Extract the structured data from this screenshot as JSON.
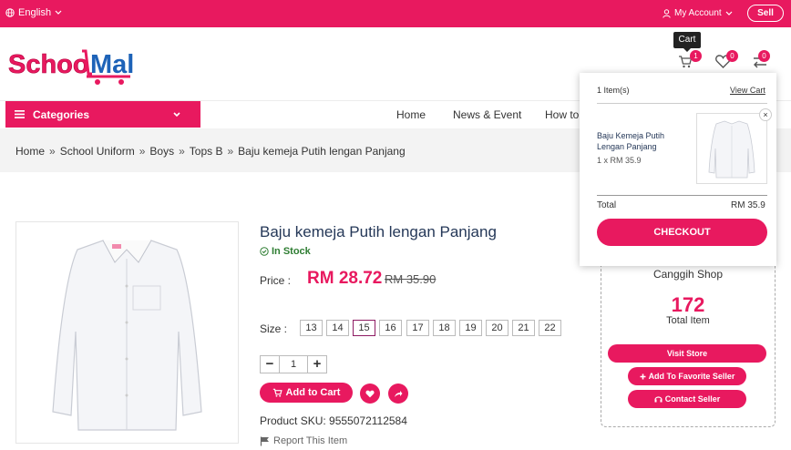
{
  "topbar": {
    "language": "English",
    "my_account": "My Account",
    "sell": "Sell"
  },
  "logo": {
    "text_a": "Schoo",
    "text_b": "Mall"
  },
  "header": {
    "cart_tooltip": "Cart",
    "cart_count": "1",
    "wishlist_count": "0",
    "compare_count": "0"
  },
  "categories": {
    "label": "Categories"
  },
  "nav": [
    "Home",
    "News & Event",
    "How to"
  ],
  "breadcrumb": [
    "Home",
    "School Uniform",
    "Boys",
    "Tops B",
    "Baju kemeja Putih lengan Panjang"
  ],
  "breadcrumb_sep": "»",
  "product": {
    "title": "Baju kemeja Putih lengan Panjang",
    "stock": "In Stock",
    "price_label": "Price :",
    "price": "RM 28.72",
    "old_price": "RM 35.90",
    "size_label": "Size :",
    "sizes": [
      "13",
      "14",
      "15",
      "16",
      "17",
      "18",
      "19",
      "20",
      "21",
      "22"
    ],
    "selected_size": "15",
    "qty_minus": "−",
    "qty": "1",
    "qty_plus": "+",
    "add_to_cart": "Add to Cart",
    "sku": "Product SKU: 9555072112584",
    "report": "Report This Item"
  },
  "seller": {
    "name": "Canggih Shop",
    "total_count": "172",
    "total_label": "Total Item",
    "visit_store": "Visit Store",
    "add_favorite": "Add To Favorite Seller",
    "contact": "Contact Seller"
  },
  "cart_popup": {
    "items": "1 Item(s)",
    "view_cart": "View Cart",
    "item_name": "Baju Kemeja Putih Lengan Panjang",
    "item_qty": "1 x RM 35.9",
    "remove": "×",
    "total_label": "Total",
    "total_value": "RM 35.9",
    "checkout": "CHECKOUT"
  },
  "colors": {
    "brand": "#e8195f",
    "title": "#253858",
    "stock": "#2e7d32"
  },
  "icons": [
    "globe-icon",
    "chevron-down-icon",
    "user-icon",
    "cart-icon",
    "heart-icon",
    "compare-icon",
    "menu-icon",
    "check-circle-icon",
    "share-icon",
    "flag-icon",
    "store-icon",
    "plus-icon",
    "headset-icon",
    "close-icon"
  ]
}
